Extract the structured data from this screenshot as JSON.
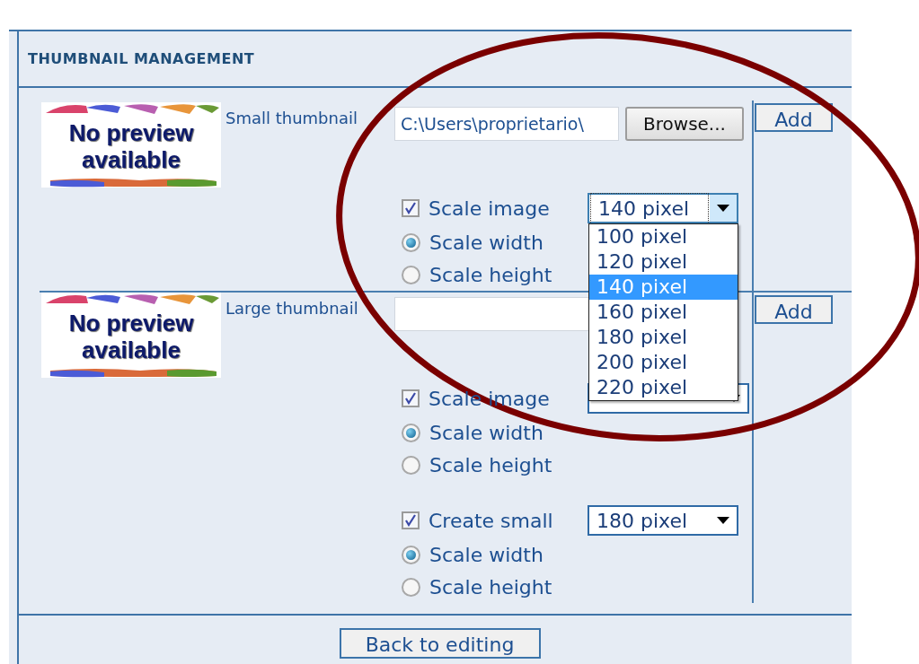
{
  "section": {
    "title": "THUMBNAIL MANAGEMENT"
  },
  "groups": [
    {
      "preview_text": "No preview available",
      "label": "Small thumbnail",
      "file_value": "C:\\Users\\proprietario\\",
      "browse_label": "Browse...",
      "add_label": "Add",
      "options": [
        {
          "kind": "checkbox",
          "label": "Scale image",
          "checked": true,
          "select": {
            "value": "140 pixel",
            "expanded": true,
            "options": [
              {
                "label": "100 pixel",
                "selected": false
              },
              {
                "label": "120 pixel",
                "selected": false
              },
              {
                "label": "140 pixel",
                "selected": true
              },
              {
                "label": "160 pixel",
                "selected": false
              },
              {
                "label": "180 pixel",
                "selected": false
              },
              {
                "label": "200 pixel",
                "selected": false
              },
              {
                "label": "220 pixel",
                "selected": false
              }
            ]
          }
        },
        {
          "kind": "radio",
          "label": "Scale width",
          "selected": true
        },
        {
          "kind": "radio",
          "label": "Scale height",
          "selected": false
        }
      ]
    },
    {
      "preview_text": "No preview available",
      "label": "Large thumbnail",
      "add_label": "Add",
      "options": [
        {
          "kind": "checkbox",
          "label": "Scale image",
          "checked": true,
          "select": {
            "expanded": false
          }
        },
        {
          "kind": "radio",
          "label": "Scale width",
          "selected": true
        },
        {
          "kind": "radio",
          "label": "Scale height",
          "selected": false
        },
        {
          "kind": "spacer"
        },
        {
          "kind": "checkbox",
          "label": "Create small",
          "checked": true,
          "select": {
            "value": "180 pixel",
            "expanded": false
          }
        },
        {
          "kind": "radio",
          "label": "Scale width",
          "selected": true
        },
        {
          "kind": "radio",
          "label": "Scale height",
          "selected": false
        }
      ]
    }
  ],
  "back_button": "Back to editing"
}
